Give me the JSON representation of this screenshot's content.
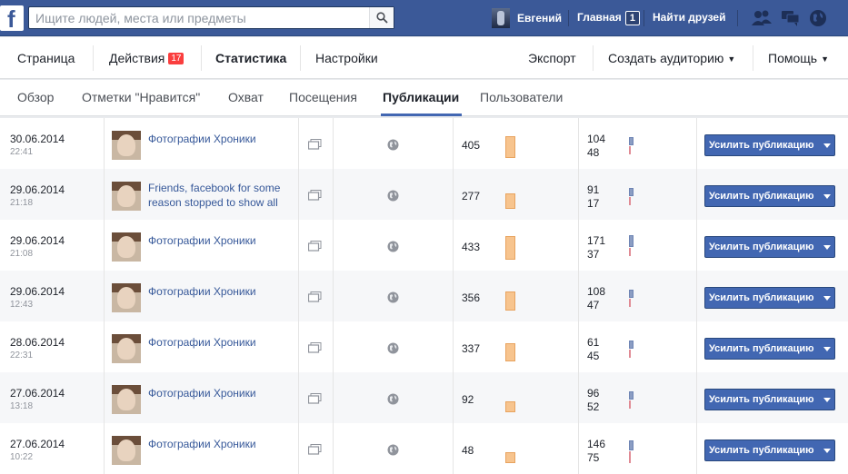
{
  "topbar": {
    "logo": "f",
    "search_placeholder": "Ищите людей, места или предметы",
    "user_name": "Евгений",
    "home_label": "Главная",
    "home_count": "1",
    "find_friends": "Найти друзей",
    "icons": [
      "friend-requests-icon",
      "messages-icon",
      "notifications-globe-icon"
    ],
    "brand_color": "#3b5998"
  },
  "pagenav": {
    "tabs": [
      "Страница",
      "Действия",
      "Статистика",
      "Настройки"
    ],
    "actions_badge": "17",
    "active_tab": "Статистика",
    "export_label": "Экспорт",
    "audience_label": "Создать аудиторию",
    "help_label": "Помощь"
  },
  "subnav": {
    "tabs": [
      "Обзор",
      "Отметки \"Нравится\"",
      "Охват",
      "Посещения",
      "Публикации",
      "Пользователи"
    ],
    "active_tab": "Публикации"
  },
  "posts": {
    "boost_label": "Усилить публикацию",
    "rows": [
      {
        "date": "30.06.2014",
        "time": "22:41",
        "title": "Фотографии Хроники",
        "reach": "405",
        "eng_top": "104",
        "eng_bottom": "48"
      },
      {
        "date": "29.06.2014",
        "time": "21:18",
        "title": "Friends, facebook for some reason stopped to show all",
        "reach": "277",
        "eng_top": "91",
        "eng_bottom": "17"
      },
      {
        "date": "29.06.2014",
        "time": "21:08",
        "title": "Фотографии Хроники",
        "reach": "433",
        "eng_top": "171",
        "eng_bottom": "37"
      },
      {
        "date": "29.06.2014",
        "time": "12:43",
        "title": "Фотографии Хроники",
        "reach": "356",
        "eng_top": "108",
        "eng_bottom": "47"
      },
      {
        "date": "28.06.2014",
        "time": "22:31",
        "title": "Фотографии Хроники",
        "reach": "337",
        "eng_top": "61",
        "eng_bottom": "45"
      },
      {
        "date": "27.06.2014",
        "time": "13:18",
        "title": "Фотографии Хроники",
        "reach": "92",
        "eng_top": "96",
        "eng_bottom": "52"
      },
      {
        "date": "27.06.2014",
        "time": "10:22",
        "title": "Фотографии Хроники",
        "reach": "48",
        "eng_top": "146",
        "eng_bottom": "75"
      }
    ]
  }
}
